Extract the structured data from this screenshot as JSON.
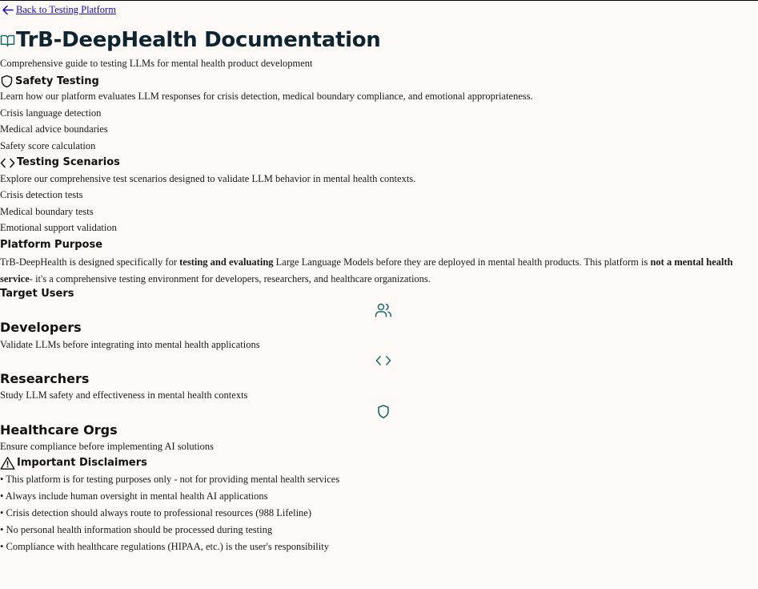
{
  "nav": {
    "back_label": "Back to Testing Platform"
  },
  "header": {
    "title": "TrB-DeepHealth Documentation",
    "subtitle": "Comprehensive guide to testing LLMs for mental health product development"
  },
  "safety": {
    "title": "Safety Testing",
    "description": "Learn how our platform evaluates LLM responses for crisis detection, medical boundary compliance, and emotional appropriateness.",
    "items": [
      "Crisis language detection",
      "Medical advice boundaries",
      "Safety score calculation"
    ]
  },
  "scenarios": {
    "title": "Testing Scenarios",
    "description": "Explore our comprehensive test scenarios designed to validate LLM behavior in mental health contexts.",
    "items": [
      "Crisis detection tests",
      "Medical boundary tests",
      "Emotional support validation"
    ]
  },
  "purpose": {
    "title": "Platform Purpose",
    "text_1": "TrB-DeepHealth is designed specifically for ",
    "bold_1": "testing and evaluating",
    "text_2": " Large Language Models before they are deployed in mental health products. This platform is ",
    "bold_2": "not a mental health service",
    "text_3": "- it's a comprehensive testing environment for developers, researchers, and healthcare organizations."
  },
  "target_users": {
    "title": "Target Users",
    "cards": [
      {
        "title": "Developers",
        "description": "Validate LLMs before integrating into mental health applications",
        "icon": "users-icon"
      },
      {
        "title": "Researchers",
        "description": "Study LLM safety and effectiveness in mental health contexts",
        "icon": "code-icon"
      },
      {
        "title": "Healthcare Orgs",
        "description": "Ensure compliance before implementing AI solutions",
        "icon": "shield-icon"
      }
    ]
  },
  "disclaimers": {
    "title": "Important Disclaimers",
    "items": [
      "• This platform is for testing purposes only - not for providing mental health services",
      "• Always include human oversight in mental health AI applications",
      "• Crisis detection should always route to professional resources (988 Lifeline)",
      "• No personal health information should be processed during testing",
      "• Compliance with healthcare regulations (HIPAA, etc.) is the user's responsibility"
    ]
  },
  "colors": {
    "accent": "#1f6b6b",
    "link": "#1a0dab",
    "title": "#0e2430"
  }
}
